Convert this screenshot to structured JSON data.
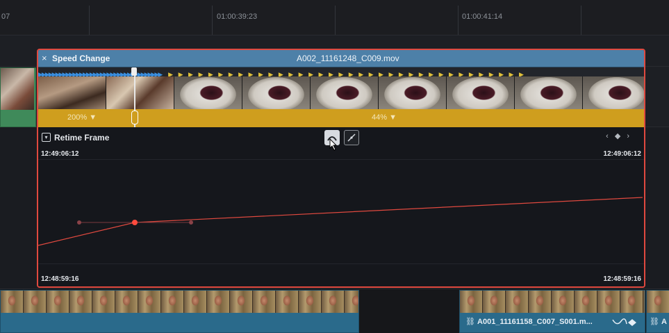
{
  "ruler": {
    "timecodes": [
      "07",
      "01:00:39:23",
      "01:00:41:14"
    ]
  },
  "speed_change": {
    "close_glyph": "×",
    "title": "Speed Change",
    "clip_name": "A002_11161248_C009.mov",
    "speed_left": "200% ▼",
    "speed_right": "44% ▼"
  },
  "retime": {
    "dropdown_glyph": "▾",
    "label": "Retime Frame",
    "tc_top_left": "12:49:06:12",
    "tc_top_right": "12:49:06:12",
    "tc_bottom_left": "12:48:59:16",
    "tc_bottom_right": "12:48:59:16",
    "keyframe_nav": "‹ ◆ ›",
    "curve_color": "#e0493f",
    "icons": [
      "smooth-curve-icon",
      "linear-curve-icon"
    ]
  },
  "bottom_clips": {
    "right_clip_label": "A001_11161158_C007_S001.m...",
    "right_clip_label_cut": "A",
    "link_glyph": "⛓"
  },
  "colors": {
    "accent_red": "#e0493f",
    "speed_bar": "#cf9e1e",
    "header_blue": "#4d80a8",
    "clip_blue": "#2a6a8b",
    "clip_green": "#3f8a5a"
  }
}
